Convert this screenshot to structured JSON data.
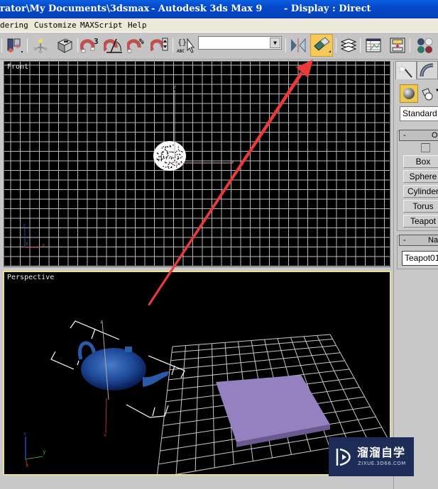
{
  "window": {
    "title_path": "rator\\My Documents\\3dsmax",
    "title_app": "- Autodesk 3ds Max 9",
    "title_display": "- Display : Direct"
  },
  "menu": {
    "items": [
      "dering",
      "Customize",
      "MAXScript",
      "Help"
    ]
  },
  "toolbar": {
    "buttons": [
      {
        "icon": "align-icon",
        "active": false
      },
      {
        "icon": "hierarchy-icon",
        "active": false
      },
      {
        "icon": "box-render-icon",
        "active": false
      },
      {
        "icon": "snap-3d-icon",
        "active": false,
        "badge": "3"
      },
      {
        "icon": "angle-snap-icon",
        "active": false
      },
      {
        "icon": "percent-snap-icon",
        "active": false,
        "badge": "%"
      },
      {
        "icon": "spinner-snap-icon",
        "active": false
      },
      {
        "icon": "edit-named-selection-icon",
        "active": false,
        "badge": "ABC"
      },
      {
        "icon": "mirror-icon",
        "active": false
      },
      {
        "icon": "align-tool-icon",
        "active": true
      },
      {
        "icon": "layer-manager-icon",
        "active": false
      },
      {
        "icon": "curve-editor-icon",
        "active": false
      },
      {
        "icon": "schematic-view-icon",
        "active": false
      },
      {
        "icon": "material-editor-icon",
        "active": false
      }
    ],
    "named_selection_value": ""
  },
  "viewports": {
    "front": {
      "label": "Front"
    },
    "perspective": {
      "label": "Perspective"
    }
  },
  "axis": {
    "x": "x",
    "y": "y",
    "z": "z"
  },
  "command_panel": {
    "tabs": [
      "create-tab",
      "modify-tab"
    ],
    "category_dropdown": "Standard Primitives",
    "object_type_rollout": {
      "title": "Object Type",
      "buttons": [
        "Box",
        "Sphere",
        "Cylinder",
        "Torus",
        "Teapot"
      ]
    },
    "name_color_rollout": {
      "title": "Name and Color",
      "name_value": "Teapot01"
    }
  },
  "colors": {
    "titlebar": "#0548c8",
    "active_button": "#f4c95a",
    "active_viewport_border": "#e6e08a",
    "teapot": "#2a5aa8",
    "plane": "#9580c0",
    "annotation_arrow": "#e83a3a"
  },
  "watermark": {
    "title": "溜溜自学",
    "url": "ZIXUE.3D66.COM"
  }
}
